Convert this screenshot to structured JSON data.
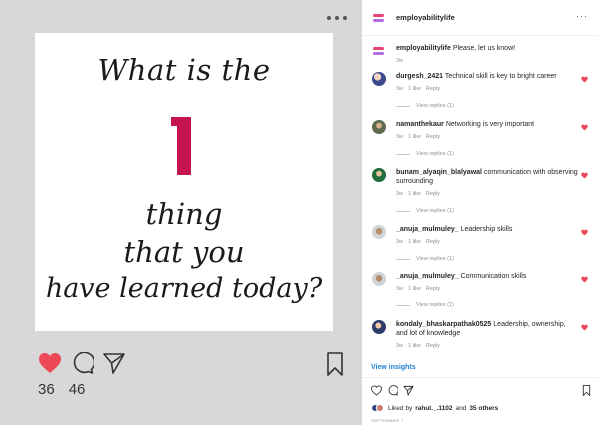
{
  "post": {
    "headline": "What is the",
    "number": "1",
    "line2": "thing",
    "line3": "that you",
    "line4": "have learned today?",
    "likes": "36",
    "comments": "46"
  },
  "panel": {
    "username": "employabilitylife",
    "more": "···",
    "caption": {
      "user": "employabilitylife",
      "text": "Please, let us know!",
      "time": "3w"
    },
    "comments": [
      {
        "user": "durgesh_2421",
        "text": "Technical skill is key to bright career",
        "time": "3w",
        "likes": "1 like",
        "reply": "Reply",
        "replies": "View replies (1)"
      },
      {
        "user": "namanthekaur",
        "text": "Networking is very important",
        "time": "3w",
        "likes": "1 like",
        "reply": "Reply",
        "replies": "View replies (1)"
      },
      {
        "user": "bunam_alyaqin_blalyawal",
        "text": "communication with observing surrounding",
        "time": "3w",
        "likes": "1 like",
        "reply": "Reply",
        "replies": "View replies (1)"
      },
      {
        "user": "_anuja_mulmuley_",
        "text": "Leadership skills",
        "time": "3w",
        "likes": "1 like",
        "reply": "Reply",
        "replies": "View replies (1)"
      },
      {
        "user": "_anuja_mulmuley_",
        "text": "Communication skills",
        "time": "3w",
        "likes": "1 like",
        "reply": "Reply",
        "replies": "View replies (1)"
      },
      {
        "user": "kondaly_bhaskarpathak0525",
        "text": "Leadership, ownership, and lot of knowledge",
        "time": "3w",
        "likes": "1 like",
        "reply": "Reply"
      }
    ],
    "insights": "View insights",
    "liked_by_prefix": "Liked by",
    "liked_by_user": "rahul._.1102",
    "liked_by_and": "and",
    "liked_by_others": "35 others",
    "date": "SEPTEMBER 7"
  },
  "colors": {
    "heart": "#ed4956",
    "accent": "#c4154f",
    "link": "#1f7fd8"
  },
  "icons": [
    "heart-icon",
    "comment-icon",
    "share-icon",
    "bookmark-icon",
    "more-icon"
  ]
}
